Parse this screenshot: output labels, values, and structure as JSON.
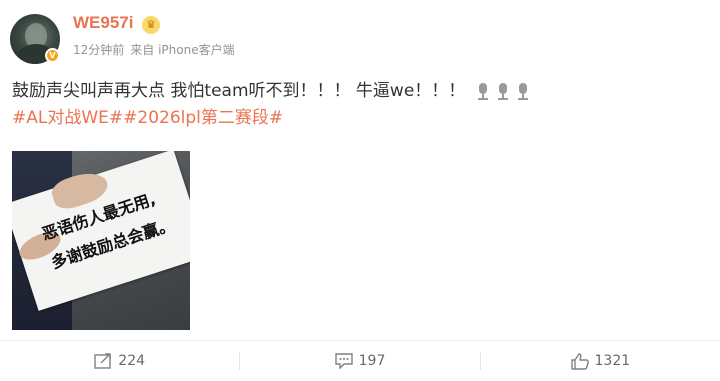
{
  "user": {
    "name": "WE957i",
    "time": "12分钟前",
    "source": "来自 iPhone客户端"
  },
  "post": {
    "text": "鼓励声尖叫声再大点 我怕team听不到！！！ 牛逼we！！！",
    "hashtags": [
      "#AL对战WE#",
      "#2026lpl第二赛段#"
    ]
  },
  "image": {
    "sign_line1": "恶语伤人最无用,",
    "sign_line2": "多谢鼓励总会赢。"
  },
  "actions": {
    "repost_count": "224",
    "comment_count": "197",
    "like_count": "1321"
  },
  "icons": [
    "microphone-icon",
    "crown-badge-icon",
    "verified-icon",
    "repost-icon",
    "comment-icon",
    "like-icon"
  ],
  "colors": {
    "accent": "#eb7350",
    "meta": "#939393",
    "text": "#333333"
  }
}
